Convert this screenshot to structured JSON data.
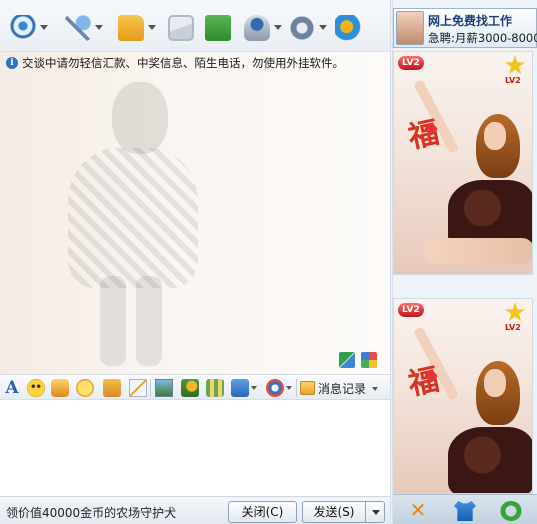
{
  "toolbar": {
    "buttons": [
      {
        "name": "webcam-icon",
        "has_dropdown": true
      },
      {
        "name": "microphone-icon",
        "has_dropdown": true
      },
      {
        "name": "folder-icon",
        "has_dropdown": true
      },
      {
        "name": "mail-icon",
        "has_dropdown": false
      },
      {
        "name": "note-icon",
        "has_dropdown": false
      },
      {
        "name": "group-icon",
        "has_dropdown": true
      },
      {
        "name": "settings-icon",
        "has_dropdown": true
      },
      {
        "name": "feature-icon",
        "has_dropdown": false
      }
    ]
  },
  "history": {
    "warning_text": "交谈中请勿轻信汇款、中奖信息、陌生电话，勿使用外挂软件。"
  },
  "format_bar": {
    "font_label": "A",
    "message_history_label": "消息记录"
  },
  "input": {
    "value": ""
  },
  "bottom_bar": {
    "ad_text": "领价值40000金币的农场守护犬",
    "close_label": "关闭(C)",
    "send_label": "发送(S)"
  },
  "right_panel": {
    "ad_banner": {
      "line1": "网上免费找工作",
      "line2": "急聘:月薪3000-8000"
    },
    "show_cards": [
      {
        "level_badge": "LV2",
        "star_level": "LV2",
        "fu_char": "福"
      },
      {
        "level_badge": "LV2",
        "star_level": "LV2",
        "fu_char": "福"
      }
    ]
  },
  "colors": {
    "accent_blue": "#2f6fc8",
    "send_border": "#8ea2ba",
    "badge_red": "#c0161d"
  }
}
